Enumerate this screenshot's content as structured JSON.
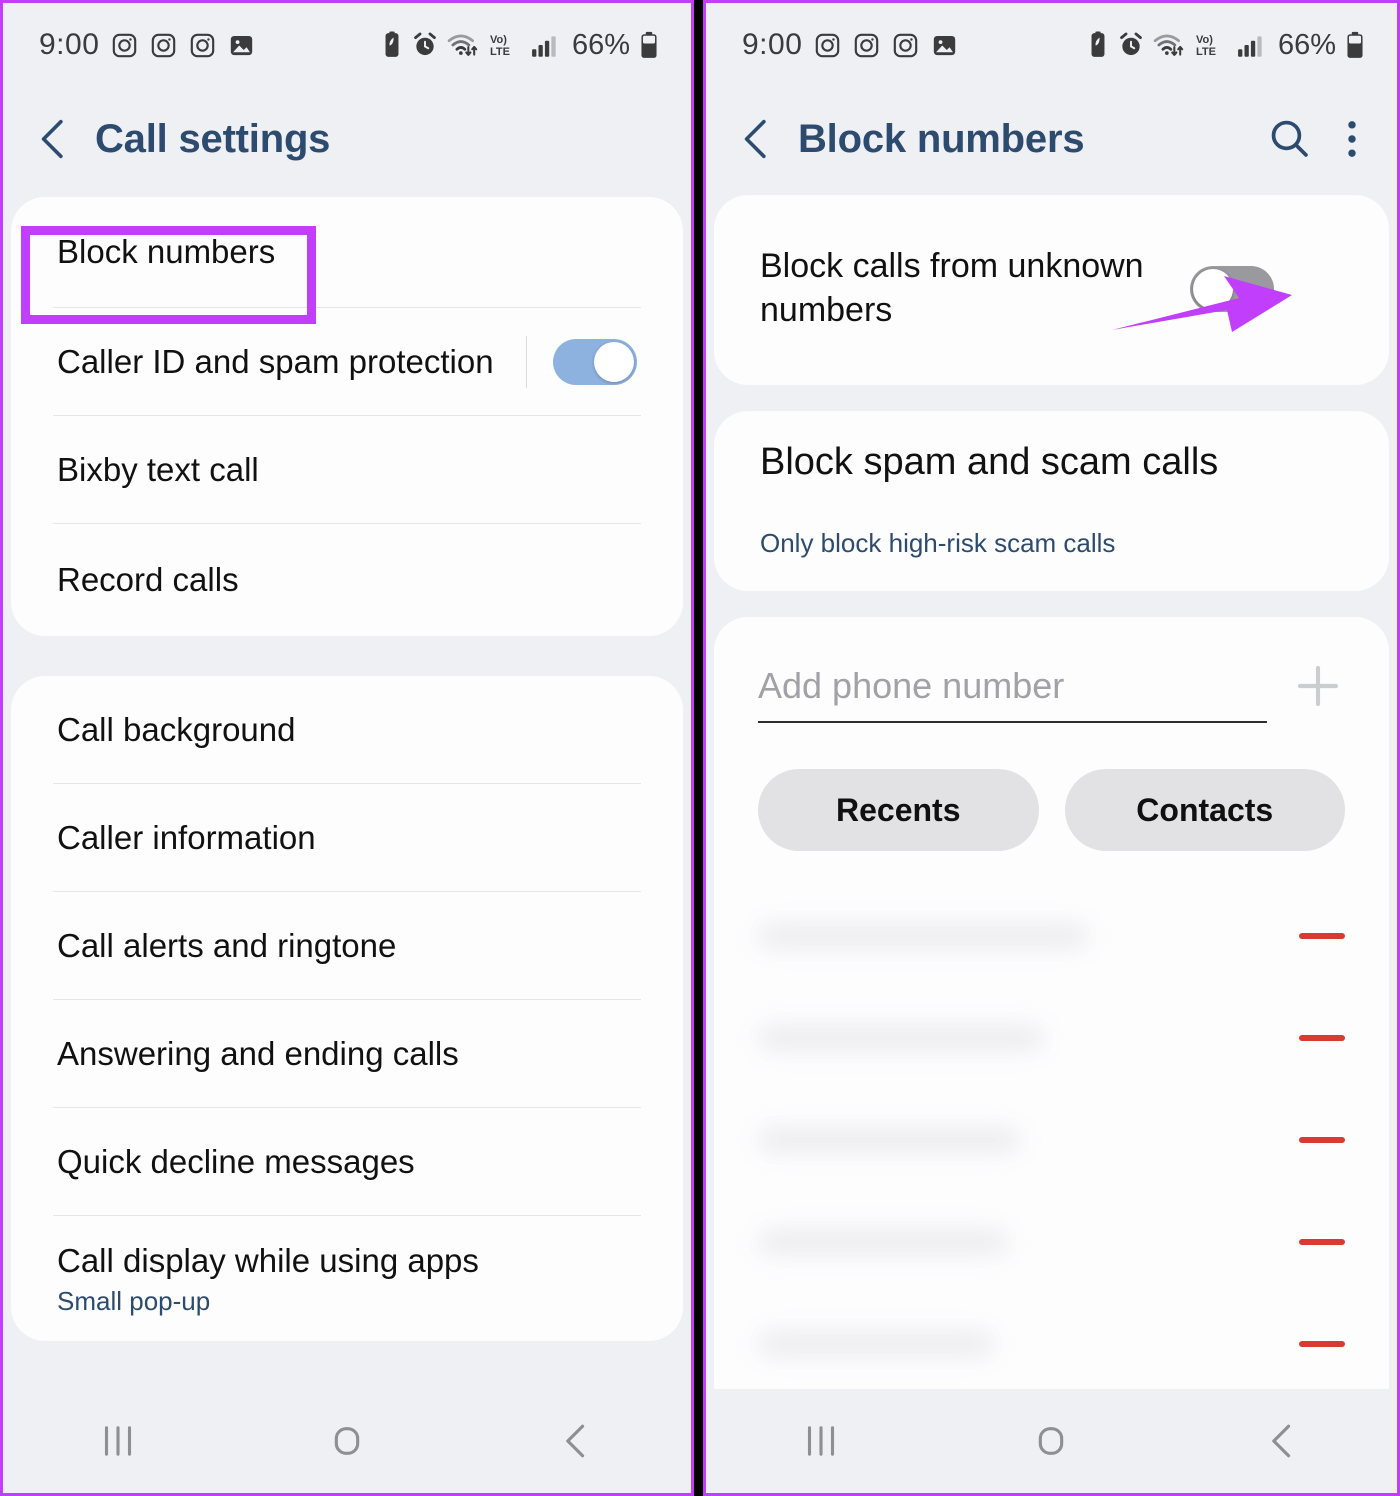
{
  "status_bar": {
    "time": "9:00",
    "left_icons": [
      "instagram-icon",
      "instagram-icon",
      "instagram-icon",
      "gallery-icon"
    ],
    "right_icons": [
      "power-saving-icon",
      "alarm-icon",
      "wifi-icon",
      "volte-icon",
      "signal-icon"
    ],
    "volte_label_top": "Vo)",
    "volte_label_bottom": "LTE",
    "battery_percent": "66%"
  },
  "left_screen": {
    "title": "Call settings",
    "back_icon": "back-chevron-icon",
    "group1": [
      {
        "label": "Block numbers",
        "highlighted": true
      },
      {
        "label": "Caller ID and spam protection",
        "toggle": "on"
      },
      {
        "label": "Bixby text call"
      },
      {
        "label": "Record calls"
      }
    ],
    "group2": [
      {
        "label": "Call background"
      },
      {
        "label": "Caller information"
      },
      {
        "label": "Call alerts and ringtone"
      },
      {
        "label": "Answering and ending calls"
      },
      {
        "label": "Quick decline messages"
      },
      {
        "label": "Call display while using apps",
        "sub": "Small pop-up"
      }
    ]
  },
  "right_screen": {
    "title": "Block numbers",
    "back_icon": "back-chevron-icon",
    "search_icon": "search-icon",
    "more_icon": "more-vertical-icon",
    "unknown": {
      "label": "Block calls from unknown numbers",
      "toggle": "off"
    },
    "spam": {
      "label": "Block spam and scam calls",
      "sub": "Only block high-risk scam calls"
    },
    "add_number": {
      "placeholder": "Add phone number",
      "value": "",
      "plus_icon": "plus-icon"
    },
    "chips": [
      {
        "label": "Recents"
      },
      {
        "label": "Contacts"
      }
    ],
    "blocked_list": {
      "rows": 5,
      "obscured": true,
      "remove_icon": "minus-icon"
    }
  },
  "nav_bar": {
    "recents_icon": "recents-icon",
    "home_icon": "home-icon",
    "back_icon": "back-icon"
  },
  "annotations": {
    "highlight_color": "#c13efc",
    "arrow_color": "#c13efc",
    "toggle_on_color": "#8db2e0",
    "toggle_off_color": "#9a9a9e",
    "accent_text_color": "#2d4b6e",
    "remove_color": "#d93a32"
  }
}
